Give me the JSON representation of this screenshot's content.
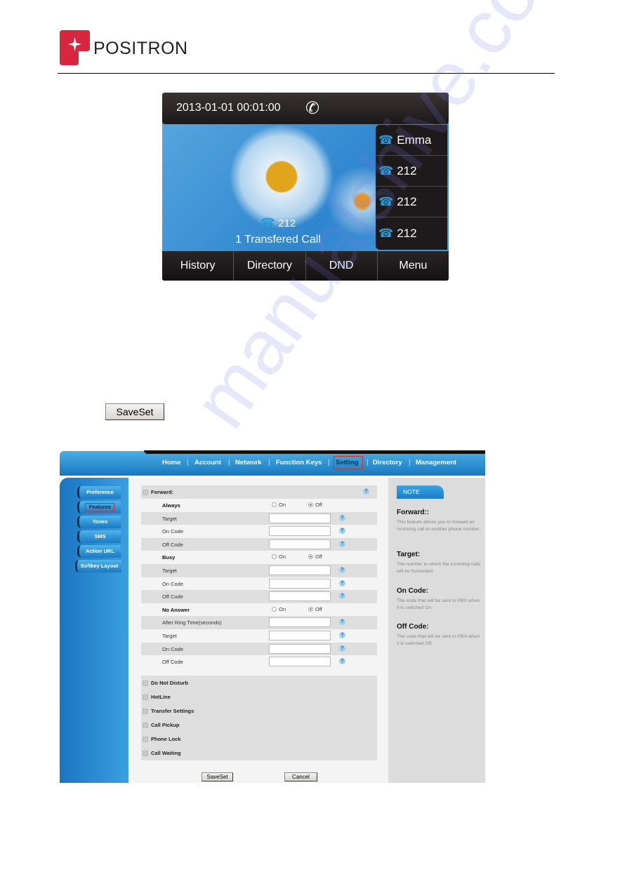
{
  "header": {
    "brand": "POSITRON",
    "brand_color": "#d7263d"
  },
  "phone_screen": {
    "datetime": "2013-01-01 00:01:00",
    "status_icon": "handset-icon",
    "lines": [
      {
        "label": "Emma"
      },
      {
        "label": "212"
      },
      {
        "label": "212"
      },
      {
        "label": "212"
      }
    ],
    "call_number": "212",
    "call_status": "1 Transfered Call",
    "softkeys": [
      "History",
      "Directory",
      "DND",
      "Menu"
    ]
  },
  "saveset_button": "SaveSet",
  "web_ui": {
    "nav": [
      "Home",
      "Account",
      "Network",
      "Function Keys",
      "Setting",
      "Directory",
      "Management"
    ],
    "nav_active": "Setting",
    "sidebar": [
      "Preference",
      "Features",
      "Tones",
      "SMS",
      "Action URL",
      "Softkey Layout"
    ],
    "sidebar_active": "Features",
    "section_title": "Forward:",
    "radio_on": "On",
    "radio_off": "Off",
    "rows": [
      {
        "label": "Always",
        "type": "radio",
        "value": "Off"
      },
      {
        "label": "Target",
        "type": "input",
        "value": ""
      },
      {
        "label": "On Code",
        "type": "input",
        "value": ""
      },
      {
        "label": "Off Code",
        "type": "input",
        "value": ""
      },
      {
        "label": "Busy",
        "type": "radio",
        "value": "Off"
      },
      {
        "label": "Target",
        "type": "input",
        "value": ""
      },
      {
        "label": "On Code",
        "type": "input",
        "value": ""
      },
      {
        "label": "Off Code",
        "type": "input",
        "value": ""
      },
      {
        "label": "No Answer",
        "type": "radio",
        "value": "Off"
      },
      {
        "label": "After Ring Time(seconds)",
        "type": "input",
        "value": ""
      },
      {
        "label": "Target",
        "type": "input",
        "value": ""
      },
      {
        "label": "On Code",
        "type": "input",
        "value": ""
      },
      {
        "label": "Off Code",
        "type": "input",
        "value": ""
      }
    ],
    "collapsed_sections": [
      "Do Not Disturb",
      "HotLine",
      "Transfer Settings",
      "Call Pickup",
      "Phone Lock",
      "Call Waiting"
    ],
    "save_label": "SaveSet",
    "cancel_label": "Cancel",
    "note": {
      "tab": "NOTE",
      "items": [
        {
          "title": "Forward::",
          "text": "This feature allows you to forward an incoming call to another phone number."
        },
        {
          "title": "Target:",
          "text": "The number to which the incoming calls will be forwarded."
        },
        {
          "title": "On Code:",
          "text": "The code that will be sent to PBX when it is switched On."
        },
        {
          "title": "Off Code:",
          "text": "The code that will be sent to PBX when it is switched Off."
        }
      ]
    }
  },
  "watermark": "manualshive.com"
}
